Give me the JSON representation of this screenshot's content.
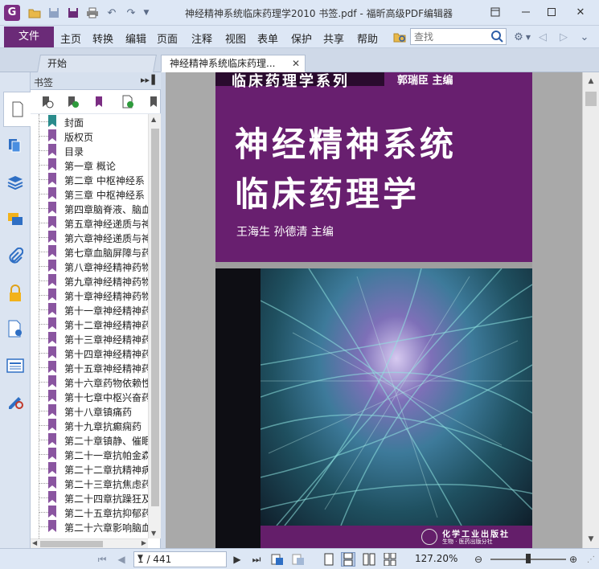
{
  "window": {
    "title": "神经精神系统临床药理学2010 书签.pdf - 福昕高级PDF编辑器"
  },
  "menubar": {
    "file": "文件",
    "items": [
      "主页",
      "转换",
      "编辑",
      "页面",
      "注释",
      "视图",
      "表单",
      "保护",
      "共享",
      "帮助"
    ],
    "search_placeholder": "查找"
  },
  "tabs": [
    {
      "label": "开始"
    },
    {
      "label": "神经精神系统临床药理..."
    }
  ],
  "bookmarks": {
    "title": "书签",
    "items": [
      "封面",
      "版权页",
      "目录",
      "第一章 概论",
      "第二章 中枢神经系",
      "第三章 中枢神经系",
      "第四章脑脊液、脑血",
      "第五章神经递质与神",
      "第六章神经递质与神",
      "第七章血脑屏障与药",
      "第八章神经精神药物",
      "第九章神经精神药物",
      "第十章神经精神药物",
      "第十一章神经精神药",
      "第十二章神经精神药",
      "第十三章神经精神药",
      "第十四章神经精神药",
      "第十五章神经精神药",
      "第十六章药物依赖性",
      "第十七章中枢兴奋药",
      "第十八章镇痛药",
      "第十九章抗癫痫药",
      "第二十章镇静、催眠",
      "第二十一章抗帕金森",
      "第二十二章抗精神病",
      "第二十三章抗焦虑药",
      "第二十四章抗躁狂及",
      "第二十五章抗抑郁药",
      "第二十六章影响脑血"
    ]
  },
  "cover": {
    "series": "临床药理学系列",
    "chief_editor": "郭瑞臣  主编",
    "title_line1": "神经精神系统",
    "title_line2": "临床药理学",
    "editors": "王海生   孙德清   主编",
    "publisher": "化学工业出版社",
    "publisher_sub": "生物 · 医药出版分社"
  },
  "statusbar": {
    "page": "1 / 441",
    "zoom": "127.20%"
  },
  "colors": {
    "accent": "#6b2b78",
    "cover_purple": "#681f6f"
  }
}
